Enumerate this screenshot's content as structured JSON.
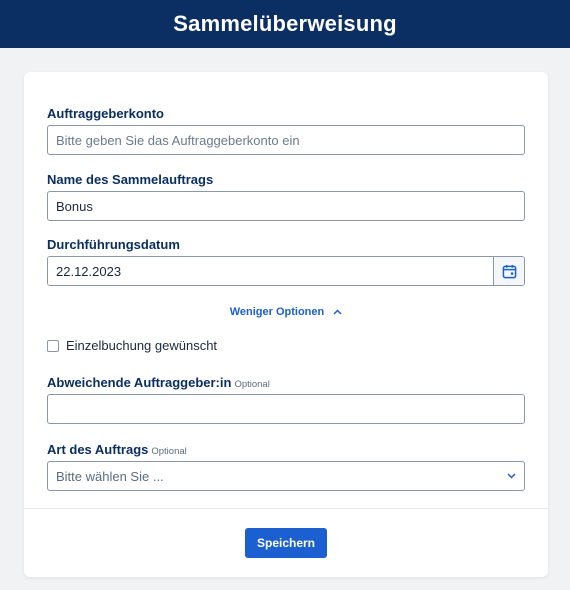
{
  "header": {
    "title": "Sammelüberweisung"
  },
  "form": {
    "auftraggeberkonto": {
      "label": "Auftraggeberkonto",
      "placeholder": "Bitte geben Sie das Auftraggeberkonto ein",
      "value": ""
    },
    "name": {
      "label": "Name des Sammelauftrags",
      "value": "Bonus"
    },
    "datum": {
      "label": "Durchführungsdatum",
      "value": "22.12.2023",
      "button_icon": "calendar-icon"
    },
    "toggle": {
      "label": "Weniger Optionen",
      "icon": "chevron-up-icon"
    },
    "einzelbuchung": {
      "label": "Einzelbuchung gewünscht",
      "checked": false
    },
    "abweichend": {
      "label": "Abweichende Auftraggeber:in",
      "optional": "Optional",
      "value": ""
    },
    "art": {
      "label": "Art des Auftrags",
      "optional": "Optional",
      "selected": "Bitte wählen Sie ...",
      "icon": "chevron-down-icon"
    },
    "save_label": "Speichern"
  },
  "colors": {
    "header_bg": "#0b2e63",
    "accent": "#1b5fd0",
    "label": "#0b2e63"
  }
}
